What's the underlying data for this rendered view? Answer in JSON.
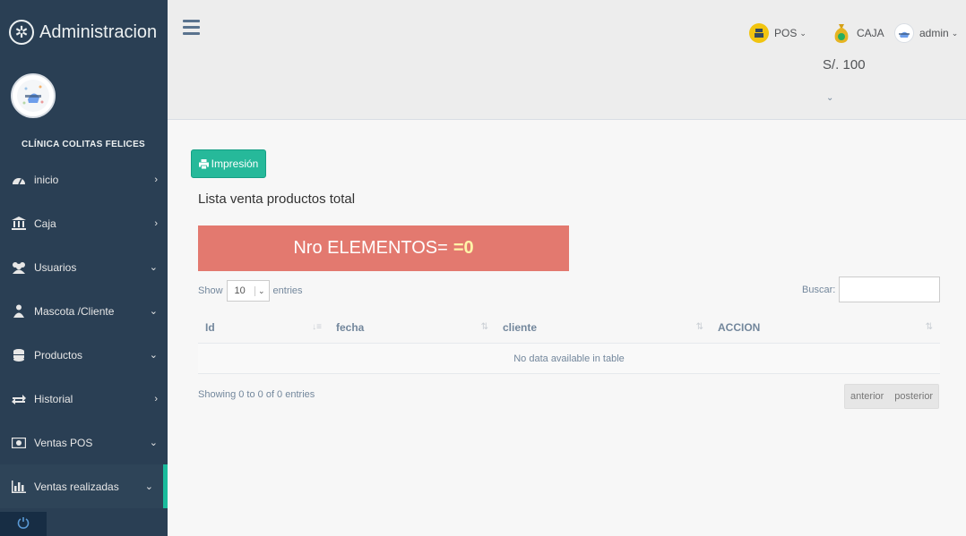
{
  "sidebar": {
    "brand_title": "Administracion",
    "clinic_name": "CLÍNICA COLITAS FELICES",
    "items": [
      {
        "label": "inicio",
        "icon": "dashboard-icon",
        "arrow": "›"
      },
      {
        "label": "Caja",
        "icon": "bank-icon",
        "arrow": "›"
      },
      {
        "label": "Usuarios",
        "icon": "users-icon",
        "arrow": "⌄"
      },
      {
        "label": "Mascota /Cliente",
        "icon": "pet-owner-icon",
        "arrow": "⌄"
      },
      {
        "label": "Productos",
        "icon": "database-icon",
        "arrow": "⌄"
      },
      {
        "label": "Historial",
        "icon": "exchange-icon",
        "arrow": "›"
      },
      {
        "label": "Ventas POS",
        "icon": "money-icon",
        "arrow": "⌄"
      },
      {
        "label": "Ventas realizadas",
        "icon": "bar-chart-icon",
        "arrow": "⌄"
      }
    ]
  },
  "topnav": {
    "pos_label": "POS",
    "caja_label": "CAJA",
    "caja_amount": "S/. 100",
    "admin_label": "admin"
  },
  "main": {
    "print_button": "Impresión",
    "list_title": "Lista venta productos total",
    "counter_label": "Nro ELEMENTOS=",
    "counter_value": "=0",
    "show_label": "Show",
    "entries_value": "10",
    "entries_label": "entries",
    "search_label": "Buscar:",
    "columns": [
      "Id",
      "fecha",
      "cliente",
      "ACCION"
    ],
    "empty_message": "No data available in table",
    "info_text": "Showing 0 to 0 of 0 entries",
    "prev_label": "anterior",
    "next_label": "posterior"
  },
  "colors": {
    "sidebar_bg": "#2a3f54",
    "accent": "#1abb9c",
    "button_green": "#26b99a",
    "counter_bg": "#e3796f"
  }
}
